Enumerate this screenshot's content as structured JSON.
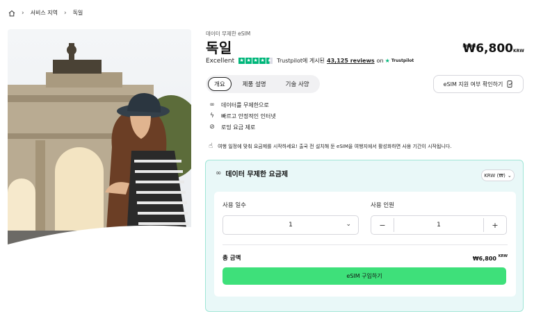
{
  "breadcrumb": {
    "home_icon": "home-icon",
    "items": [
      "서비스 지역",
      "독일"
    ]
  },
  "product": {
    "subtitle": "데이터 무제한 eSIM",
    "title": "독일",
    "price": "₩6,800",
    "currency": "KRW"
  },
  "rating": {
    "label": "Excellent",
    "stars": 4.5,
    "posted_on": "Trustpilot에 게시된",
    "reviews": "43,125 reviews",
    "on": "on",
    "brand": "Trustpilot",
    "star_color": "#00b67a"
  },
  "tabs": [
    "개요",
    "제품 설명",
    "기술 사양"
  ],
  "check_button": "eSIM 지원 여부 확인하기",
  "features": [
    {
      "icon": "infinity-icon",
      "label": "데이터를 무제한으로"
    },
    {
      "icon": "lightning-icon",
      "label": "빠르고 안정적인 인터넷"
    },
    {
      "icon": "no-roaming-icon",
      "label": "로밍 요금 제로"
    }
  ],
  "notice": "여행 일정에 맞춰 요금제를 시작하세요! 출국 전 설치해 둔 eSIM을 여행지에서 활성화하면 사용 기간이 시작됩니다.",
  "plan": {
    "title": "데이터 무제한 요금제",
    "currency_select": "KRW (₩)",
    "days_label": "사용 일수",
    "days_value": "1",
    "people_label": "사용 인원",
    "people_value": "1",
    "total_label": "총 금액",
    "total_value": "₩6,800",
    "total_currency": "KRW",
    "buy_button": "eSIM 구입하기",
    "accent_color": "#3ee07a"
  }
}
